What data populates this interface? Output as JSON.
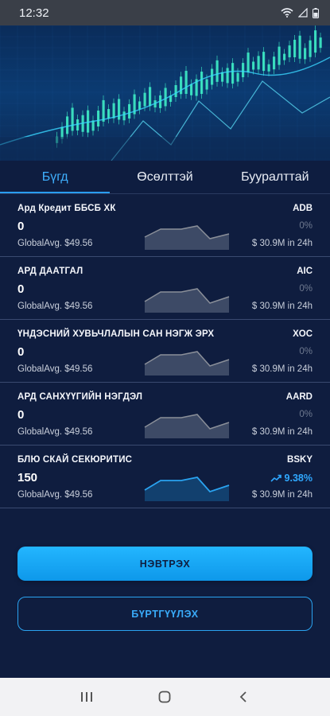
{
  "status_bar": {
    "time": "12:32"
  },
  "tabs": [
    {
      "label": "Бүгд",
      "active": true
    },
    {
      "label": "Өсөлттэй",
      "active": false
    },
    {
      "label": "Бууралттай",
      "active": false
    }
  ],
  "stocks": [
    {
      "name": "Ард Кредит ББСБ ХК",
      "ticker": "ADB",
      "price": "0",
      "avg": "GlobalAvg. $49.56",
      "change": "0%",
      "volume": "$ 30.9M in 24h",
      "trend": "flat"
    },
    {
      "name": "АРД ДААТГАЛ",
      "ticker": "AIC",
      "price": "0",
      "avg": "GlobalAvg. $49.56",
      "change": "0%",
      "volume": "$ 30.9M in 24h",
      "trend": "flat"
    },
    {
      "name": "ҮНДЭСНИЙ ХУВЬЧЛАЛЫН САН НЭГЖ ЭРХ",
      "ticker": "XOC",
      "price": "0",
      "avg": "GlobalAvg. $49.56",
      "change": "0%",
      "volume": "$ 30.9M in 24h",
      "trend": "flat"
    },
    {
      "name": "АРД САНХҮҮГИЙН НЭГДЭЛ",
      "ticker": "AARD",
      "price": "0",
      "avg": "GlobalAvg. $49.56",
      "change": "0%",
      "volume": "$ 30.9M in 24h",
      "trend": "flat"
    },
    {
      "name": "БЛЮ СКАЙ СЕКЮРИТИС",
      "ticker": "BSKY",
      "price": "150",
      "avg": "GlobalAvg. $49.56",
      "change": "9.38%",
      "volume": "$ 30.9M in 24h",
      "trend": "up"
    }
  ],
  "buttons": {
    "login": "НЭВТРЭХ",
    "register": "БҮРТГҮҮЛЭХ"
  },
  "colors": {
    "background": "#0f1d3f",
    "accent": "#2aa3f0",
    "positive": "#2fa8ff",
    "neutral_spark": "#8a8f99"
  }
}
